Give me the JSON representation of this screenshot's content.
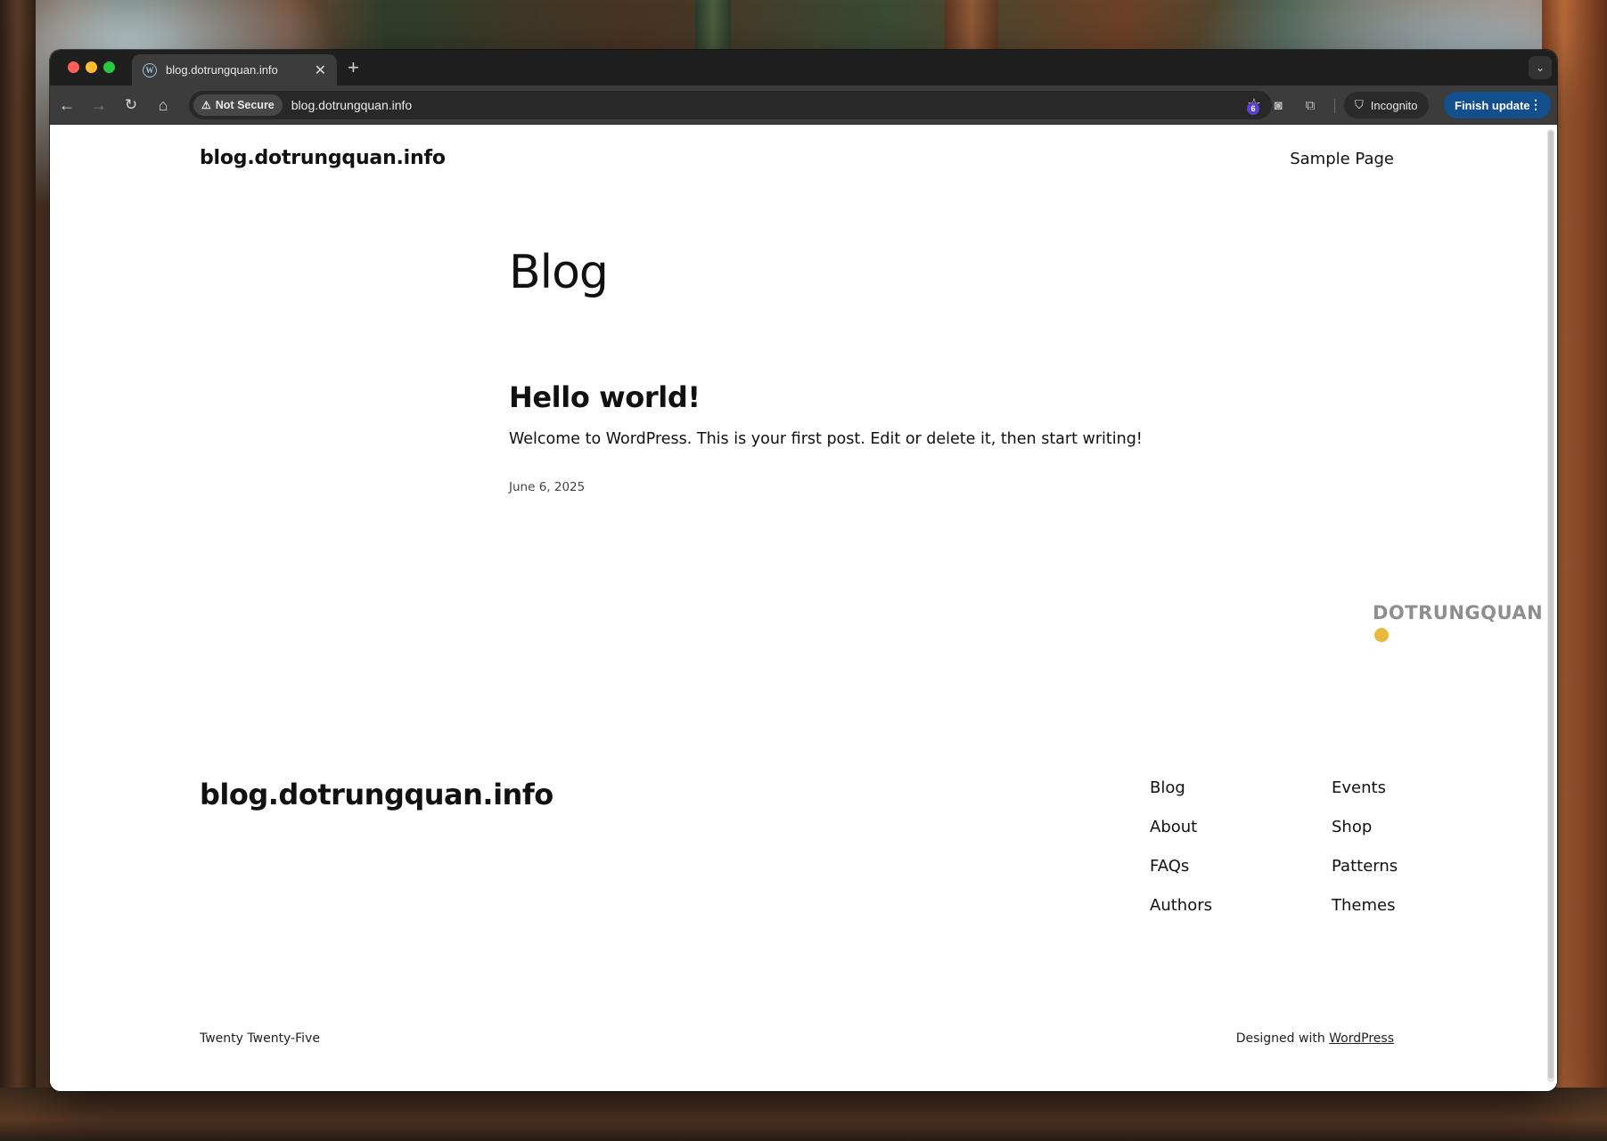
{
  "browser": {
    "tab_title": "blog.dotrungquan.info",
    "new_tab_symbol": "+",
    "security_label": "Not Secure",
    "url": "blog.dotrungquan.info",
    "extension_badge_count": "6",
    "incognito_label": "Incognito",
    "update_button_label": "Finish update",
    "icons": {
      "favicon": "wordpress-icon",
      "back": "back-arrow-icon",
      "forward": "forward-arrow-icon",
      "reload": "reload-icon",
      "home": "home-icon",
      "security": "warning-icon",
      "bookmark": "star-icon",
      "screenshot": "camera-icon",
      "extensions": "puzzle-icon",
      "incognito": "incognito-icon"
    },
    "colors": {
      "tabbar": "#1f1f1f",
      "toolbar": "#3c3c3c",
      "update_button": "#124f8c",
      "badge": "#5b3fd1"
    }
  },
  "site": {
    "header_title": "blog.dotrungquan.info",
    "nav_sample_page": "Sample Page",
    "page_heading": "Blog",
    "post": {
      "title": "Hello world!",
      "excerpt": "Welcome to WordPress. This is your first post. Edit or delete it, then start writing!",
      "date": "June 6, 2025"
    },
    "watermark": "DOTRUNGQUAN",
    "footer": {
      "title": "blog.dotrungquan.info",
      "nav_col1": [
        "Blog",
        "About",
        "FAQs",
        "Authors"
      ],
      "nav_col2": [
        "Events",
        "Shop",
        "Patterns",
        "Themes"
      ],
      "theme_name": "Twenty Twenty-Five",
      "designed_with_prefix": "Designed with",
      "designed_with_link": "WordPress"
    }
  }
}
